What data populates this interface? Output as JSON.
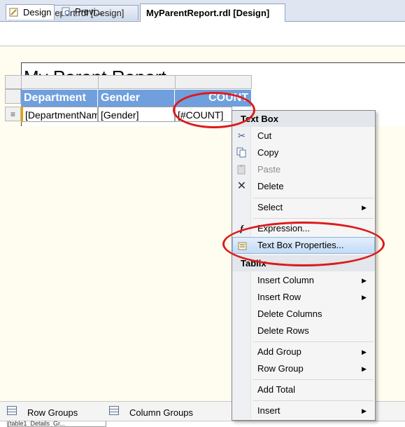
{
  "doc_tabs": [
    {
      "label": "MyChildReport.rdl [Design]",
      "active": false
    },
    {
      "label": "MyParentReport.rdl [Design]",
      "active": true
    }
  ],
  "view_tabs": {
    "design": "Design",
    "preview": "Previ..."
  },
  "report": {
    "title_partial": "My Parent Report",
    "headers": [
      "Department",
      "Gender",
      "COUNT"
    ],
    "detail": [
      "[DepartmentName]",
      "[Gender]",
      "[#COUNT]"
    ]
  },
  "groups": {
    "row": "Row Groups",
    "column": "Column Groups",
    "bottom_item": "(table1_Details_Gr..."
  },
  "context_menu": {
    "section1": "Text Box",
    "cut": "Cut",
    "copy": "Copy",
    "paste": "Paste",
    "delete": "Delete",
    "select": "Select",
    "expression": "Expression...",
    "properties": "Text Box Properties...",
    "section2": "Tablix",
    "insert_column": "Insert Column",
    "insert_row": "Insert Row",
    "delete_columns": "Delete Columns",
    "delete_rows": "Delete Rows",
    "add_group": "Add Group",
    "row_group": "Row Group",
    "add_total": "Add Total",
    "insert": "Insert"
  },
  "colors": {
    "header_blue": "#6f9fdd",
    "annotation_red": "#dd1a1a",
    "highlight": "#c4dbf6"
  }
}
